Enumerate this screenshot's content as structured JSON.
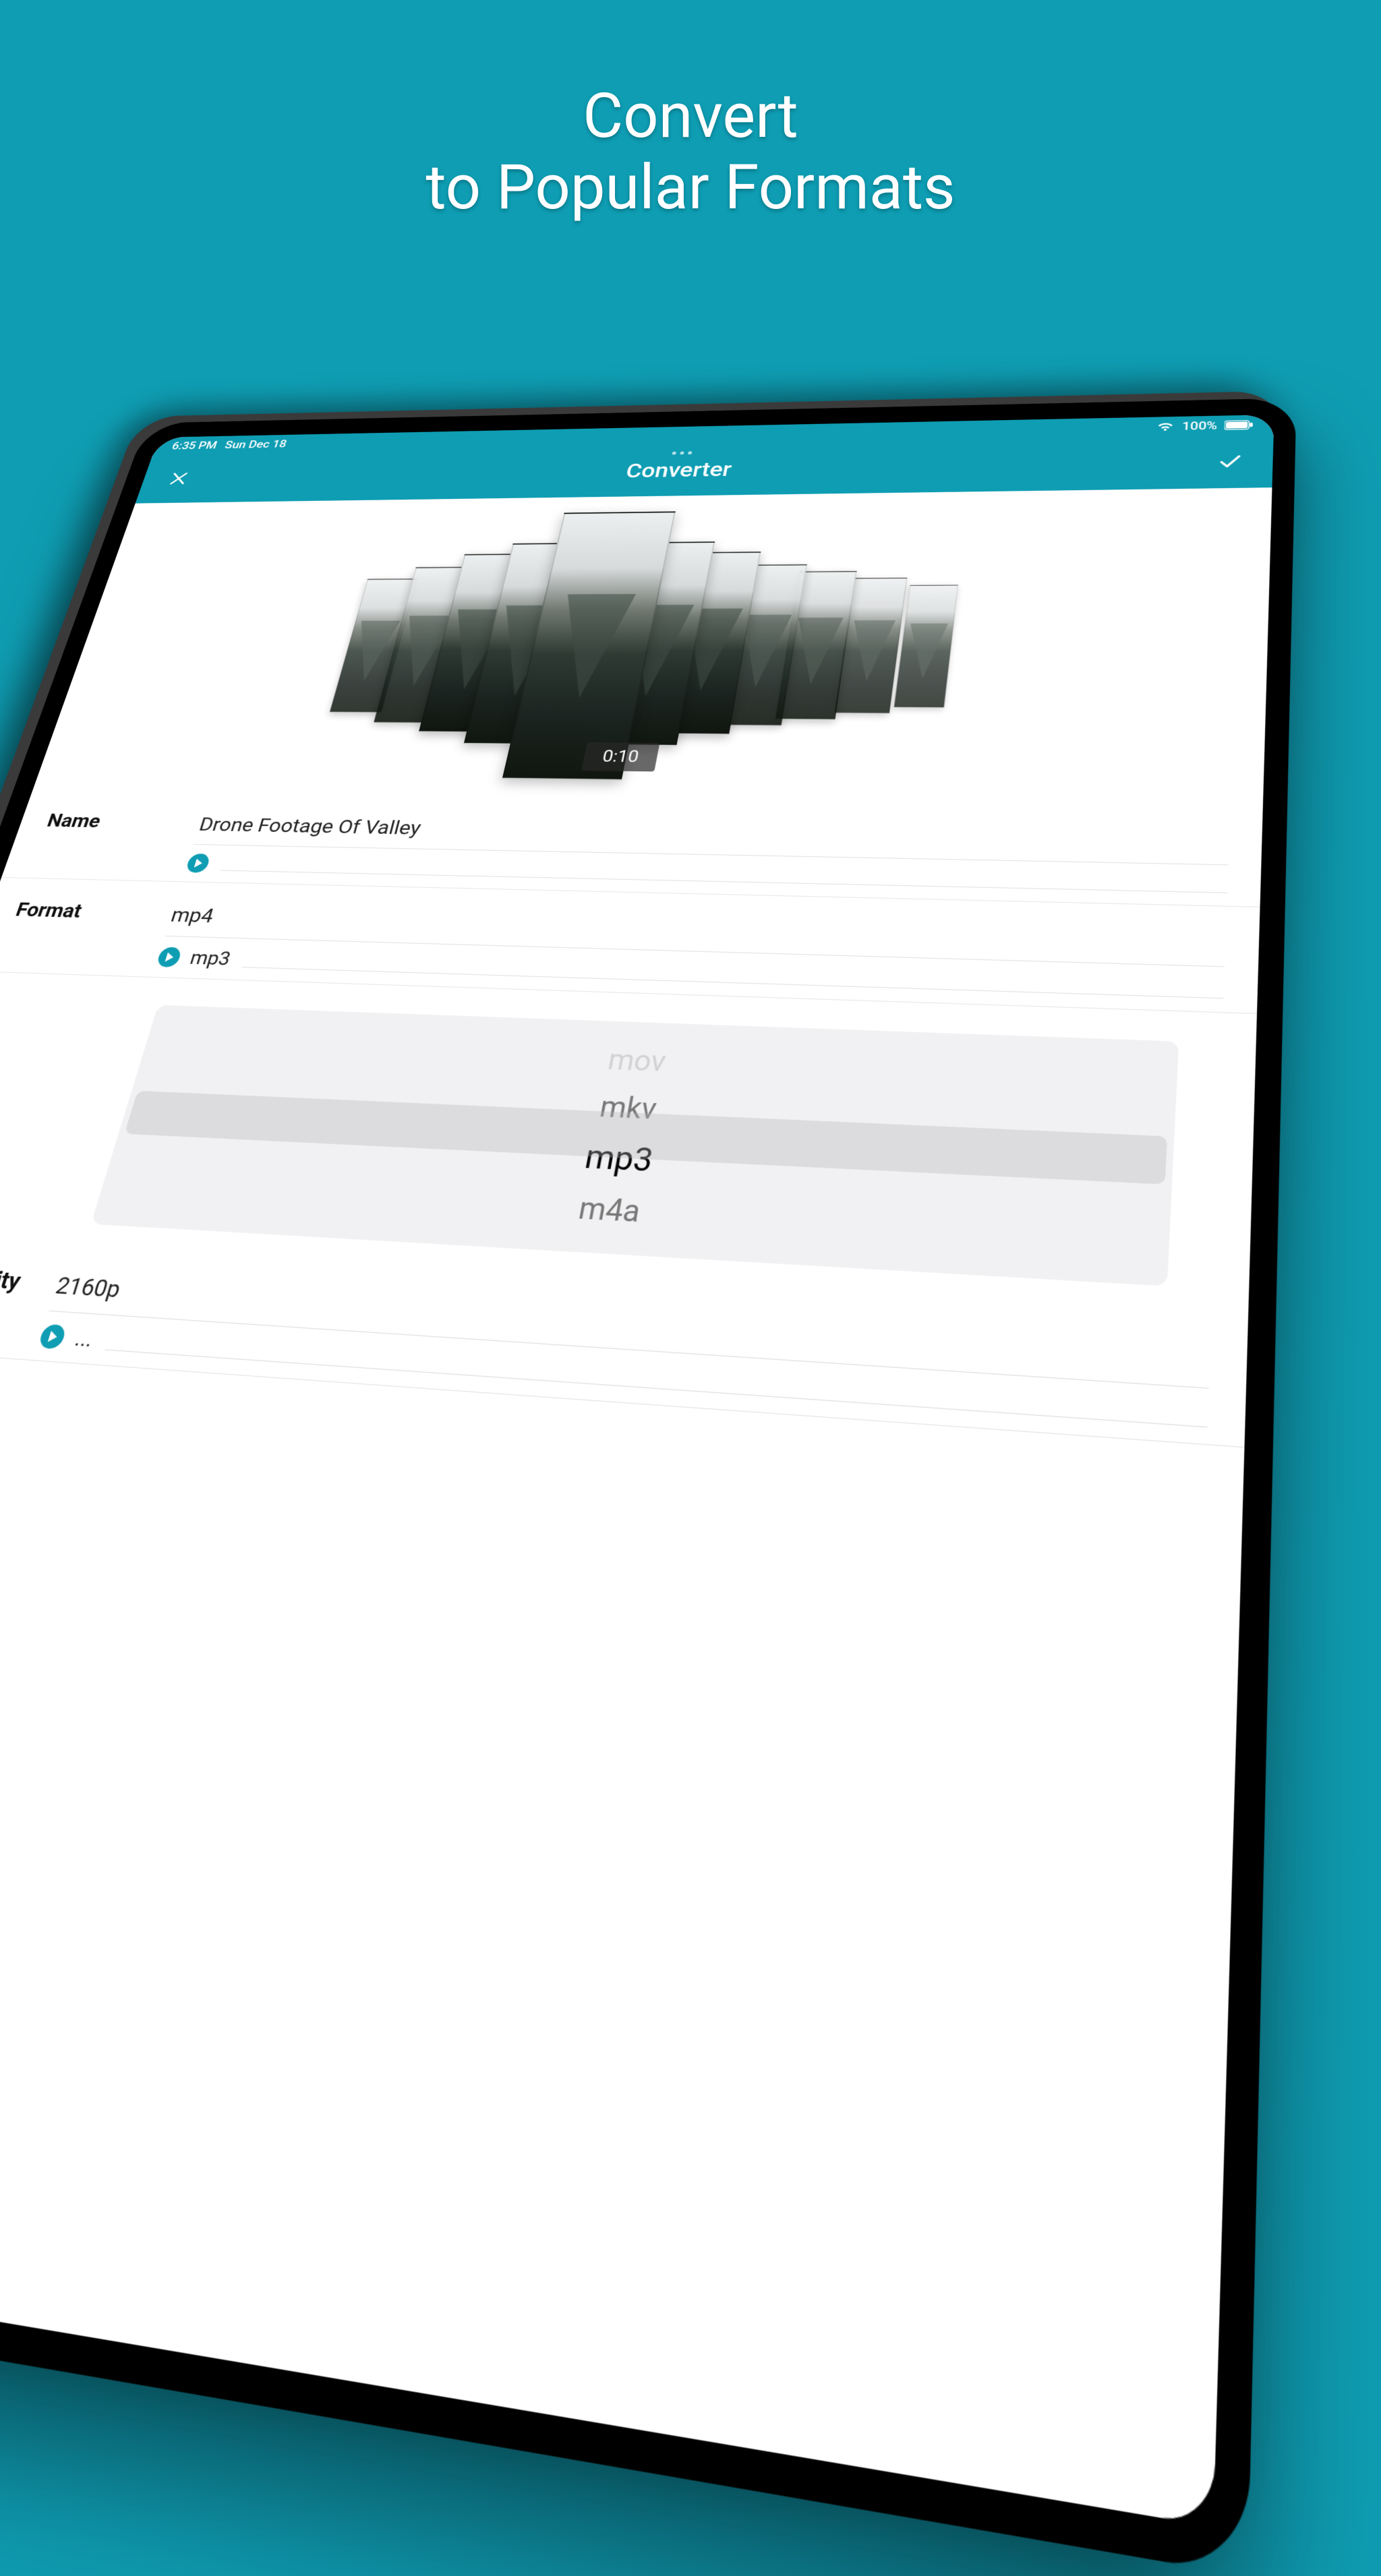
{
  "marketing": {
    "title": "Convert\nto Popular Formats"
  },
  "statusBar": {
    "time": "6:35 PM",
    "date": "Sun Dec 18",
    "batteryPercent": "100%"
  },
  "nav": {
    "title": "Converter"
  },
  "preview": {
    "timestamp": "0:10"
  },
  "fields": {
    "name": {
      "label": "Name",
      "value": "Drone Footage Of Valley"
    },
    "format": {
      "label": "Format",
      "current": "mp4",
      "target": "mp3"
    },
    "picker": {
      "items": [
        "mov",
        "mkv",
        "mp3",
        "m4a"
      ],
      "selectedIndex": 2
    },
    "videoQuality": {
      "label": "Video Quality",
      "current": "2160p",
      "target": "..."
    }
  }
}
